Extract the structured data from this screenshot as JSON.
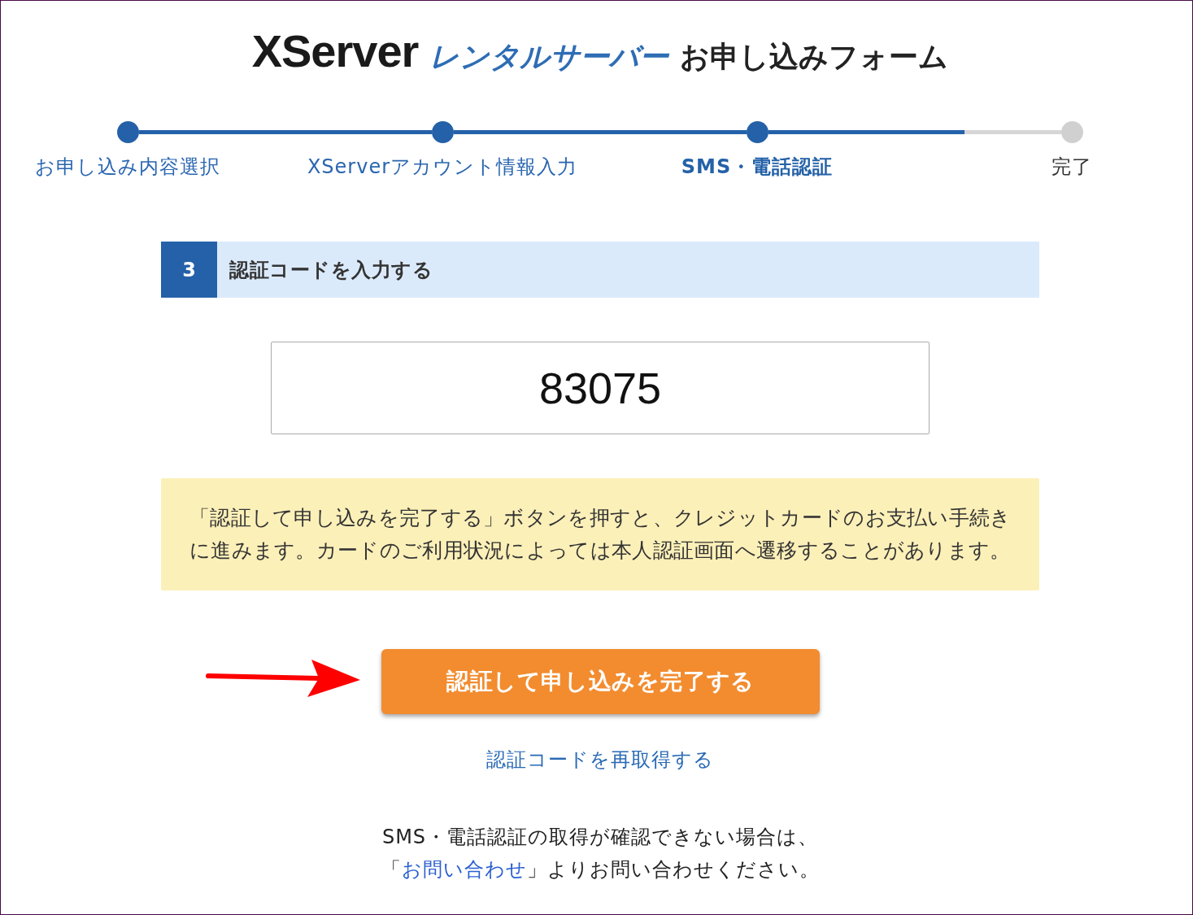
{
  "header": {
    "brand": "XServer",
    "product": "レンタルサーバー",
    "title": "お申し込みフォーム"
  },
  "stepper": {
    "steps": [
      {
        "label": "お申し込み内容選択",
        "reached": true,
        "current": false
      },
      {
        "label": "XServerアカウント情報入力",
        "reached": true,
        "current": false
      },
      {
        "label": "SMS・電話認証",
        "reached": true,
        "current": true
      },
      {
        "label": "完了",
        "reached": false,
        "current": false
      }
    ],
    "connectors": [
      {
        "level": 1
      },
      {
        "level": 1
      },
      {
        "level": 0.67
      }
    ]
  },
  "section": {
    "number": "3",
    "title": "認証コードを入力する"
  },
  "code_field": {
    "value": "83075"
  },
  "notice": {
    "text": "「認証して申し込みを完了する」ボタンを押すと、クレジットカードのお支払い手続きに進みます。カードのご利用状況によっては本人認証画面へ遷移することがあります。"
  },
  "submit_button": {
    "label": "認証して申し込みを完了する"
  },
  "annotation": {
    "kind": "arrow"
  },
  "resend_link": {
    "label": "認証コードを再取得する"
  },
  "contact_note": {
    "line_1": "SMS・電話認証の取得が確認できない場合は、",
    "line_2_before": "「",
    "link": "お問い合わせ",
    "line_2_after": "」よりお問い合わせください。"
  }
}
